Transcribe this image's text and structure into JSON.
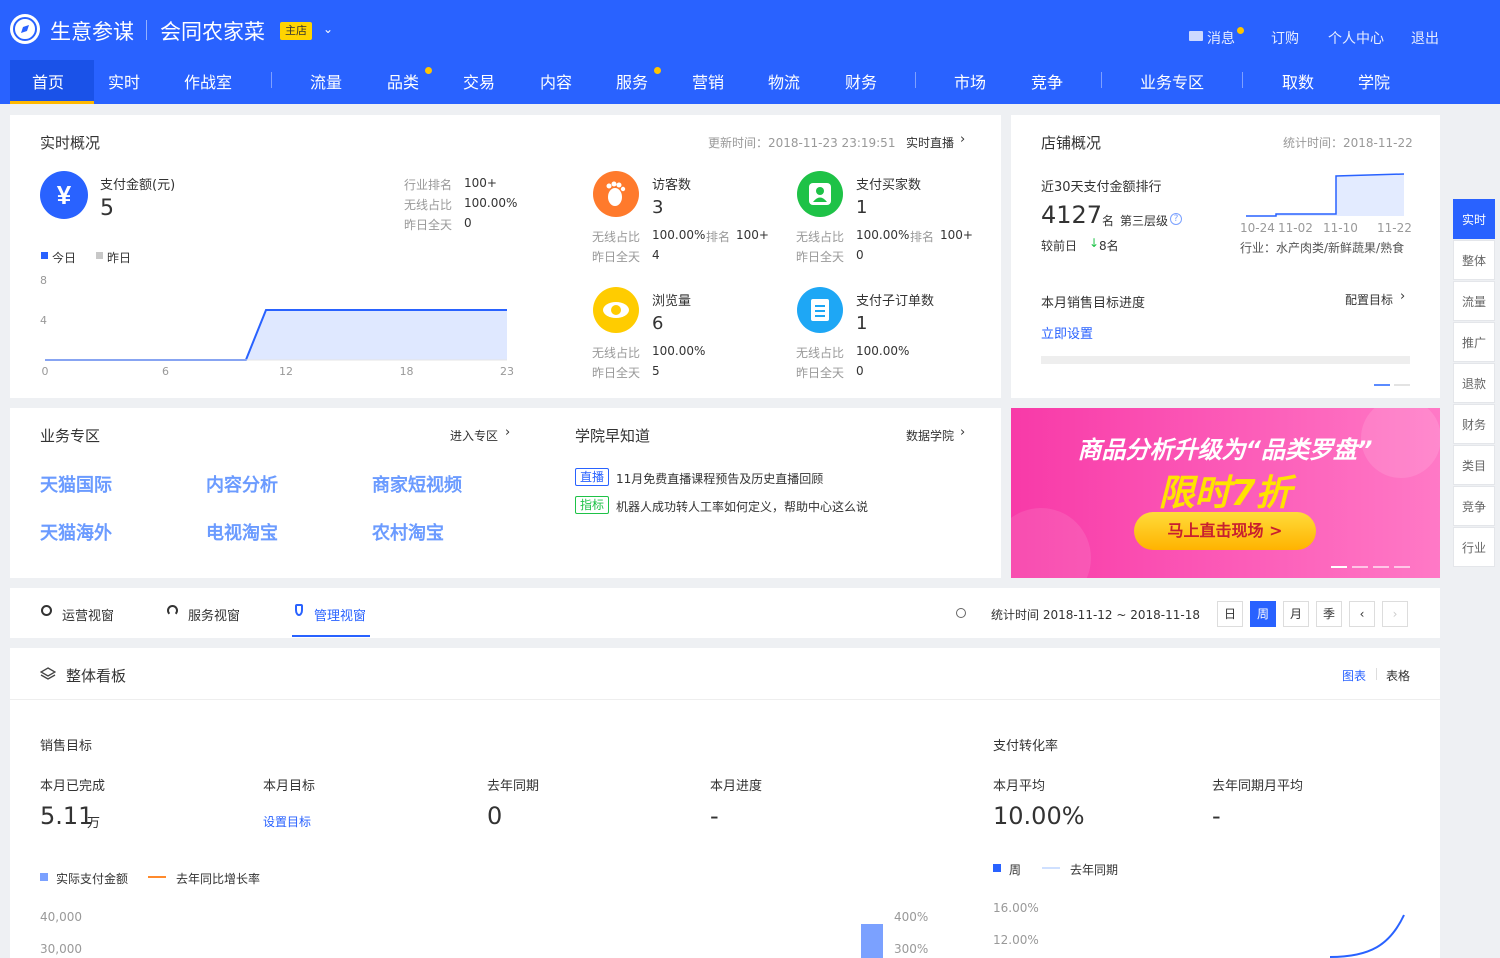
{
  "header": {
    "brand": "生意参谋",
    "shop_name": "会同农家菜",
    "shop_badge": "主店",
    "links": {
      "messages": "消息",
      "subscribe": "订购",
      "personal": "个人中心",
      "logout": "退出"
    },
    "nav": [
      "首页",
      "实时",
      "作战室",
      "流量",
      "品类",
      "交易",
      "内容",
      "服务",
      "营销",
      "物流",
      "财务",
      "市场",
      "竞争",
      "业务专区",
      "取数",
      "学院"
    ]
  },
  "realtime": {
    "title": "实时概况",
    "update_time": "更新时间：2018-11-23 23:19:51",
    "live_link": "实时直播",
    "pay_label": "支付金额(元)",
    "pay_value": "5",
    "stats_labels": [
      "行业排名",
      "无线占比",
      "昨日全天"
    ],
    "stats_values": [
      "100+",
      "100.00%",
      "0"
    ],
    "legend_today": "今日",
    "legend_yesterday": "昨日",
    "metrics": [
      {
        "label": "访客数",
        "value": "3",
        "l1": "无线占比",
        "v1": "100.00%",
        "rank_label": "排名",
        "rank": "100+",
        "l2": "昨日全天",
        "v2": "4"
      },
      {
        "label": "支付买家数",
        "value": "1",
        "l1": "无线占比",
        "v1": "100.00%",
        "rank_label": "排名",
        "rank": "100+",
        "l2": "昨日全天",
        "v2": "0"
      },
      {
        "label": "浏览量",
        "value": "6",
        "l1": "无线占比",
        "v1": "100.00%",
        "l2": "昨日全天",
        "v2": "5"
      },
      {
        "label": "支付子订单数",
        "value": "1",
        "l1": "无线占比",
        "v1": "100.00%",
        "l2": "昨日全天",
        "v2": "0"
      }
    ]
  },
  "shop_overview": {
    "title": "店铺概况",
    "stat_time": "统计时间：2018-11-22",
    "rank_title": "近30天支付金额排行",
    "rank_value": "4127",
    "rank_unit": "名",
    "tier": "第三层级",
    "compare_label": "较前日",
    "compare_value": "8名",
    "spark_dates": [
      "10-24",
      "11-02",
      "11-10",
      "11-22"
    ],
    "industry": "行业：水产肉类/新鲜蔬果/熟食",
    "target_title": "本月销售目标进度",
    "config_target": "配置目标",
    "set_now": "立即设置"
  },
  "business": {
    "title": "业务专区",
    "enter": "进入专区",
    "links": [
      "天猫国际",
      "内容分析",
      "商家短视频",
      "天猫海外",
      "电视淘宝",
      "农村淘宝"
    ]
  },
  "academy": {
    "title": "学院早知道",
    "link": "数据学院",
    "items": [
      {
        "tag": "直播",
        "text": "11月免费直播课程预告及历史直播回顾"
      },
      {
        "tag": "指标",
        "text": "机器人成功转人工率如何定义，帮助中心这么说"
      }
    ]
  },
  "banner": {
    "line1": "商品分析升级为“品类罗盘”",
    "line2": "限时7折",
    "button": "马上直击现场 >"
  },
  "view_tabs": {
    "tabs": [
      "运营视窗",
      "服务视窗",
      "管理视窗"
    ],
    "stat_period": "统计时间 2018-11-12 ~ 2018-11-18",
    "periods": [
      "日",
      "周",
      "月",
      "季"
    ]
  },
  "dashboard": {
    "title": "整体看板",
    "view_chart": "图表",
    "view_table": "表格",
    "sales_title": "销售目标",
    "cols": [
      {
        "label": "本月已完成",
        "value": "5.11",
        "unit": "万"
      },
      {
        "label": "本月目标",
        "value": "设置目标"
      },
      {
        "label": "去年同期",
        "value": "0"
      },
      {
        "label": "本月进度",
        "value": "-"
      }
    ],
    "legend_actual": "实际支付金额",
    "legend_yoy": "去年同比增长率",
    "left_ticks": [
      "40,000",
      "30,000"
    ],
    "right_ticks": [
      "400%",
      "300%"
    ],
    "conv_title": "支付转化率",
    "conv_cols": [
      {
        "label": "本月平均",
        "value": "10.00%"
      },
      {
        "label": "去年同期月平均",
        "value": "-"
      }
    ],
    "legend_week": "周",
    "legend_lastyear": "去年同期",
    "conv_ticks": [
      "16.00%",
      "12.00%"
    ]
  },
  "sidebar": [
    "实时",
    "整体",
    "流量",
    "推广",
    "退款",
    "财务",
    "类目",
    "竞争",
    "行业"
  ],
  "chart_data": {
    "type": "area",
    "x": [
      0,
      1,
      2,
      3,
      4,
      5,
      6,
      7,
      8,
      9,
      10,
      11,
      12,
      13,
      14,
      15,
      16,
      17,
      18,
      19,
      20,
      21,
      22,
      23
    ],
    "series": [
      {
        "name": "今日",
        "values": [
          0,
          0,
          0,
          0,
          0,
          0,
          0,
          0,
          0,
          0,
          0,
          5,
          5,
          5,
          5,
          5,
          5,
          5,
          5,
          5,
          5,
          5,
          5,
          5
        ]
      }
    ],
    "xticks": [
      "0",
      "6",
      "12",
      "18",
      "23"
    ],
    "yticks": [
      "8",
      "4"
    ],
    "ylim": [
      0,
      8
    ],
    "xlim": [
      0,
      23
    ]
  }
}
